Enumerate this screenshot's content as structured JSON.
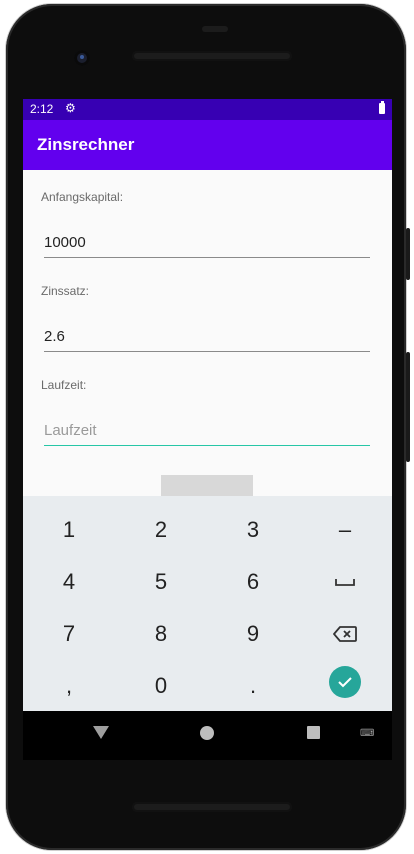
{
  "status_bar": {
    "time": "2:12",
    "settings_icon": "gear-icon",
    "battery_icon": "battery-icon"
  },
  "app_bar": {
    "title": "Zinsrechner"
  },
  "form": {
    "fields": [
      {
        "label": "Anfangskapital:",
        "value": "10000",
        "placeholder": ""
      },
      {
        "label": "Zinssatz:",
        "value": "2.6",
        "placeholder": ""
      },
      {
        "label": "Laufzeit:",
        "value": "",
        "placeholder": "Laufzeit"
      }
    ]
  },
  "keyboard": {
    "keys": [
      "1",
      "2",
      "3",
      "–",
      "4",
      "5",
      "6",
      "space",
      "7",
      "8",
      "9",
      "backspace",
      ",",
      "0",
      ".",
      "done"
    ]
  },
  "colors": {
    "status_bar": "#3700b3",
    "app_bar": "#6200ee",
    "accent": "#26c6a6",
    "done_button": "#26a69a"
  },
  "nav_bar": {
    "icons": [
      "back-icon",
      "home-icon",
      "recents-icon",
      "keyboard-switch-icon"
    ]
  }
}
